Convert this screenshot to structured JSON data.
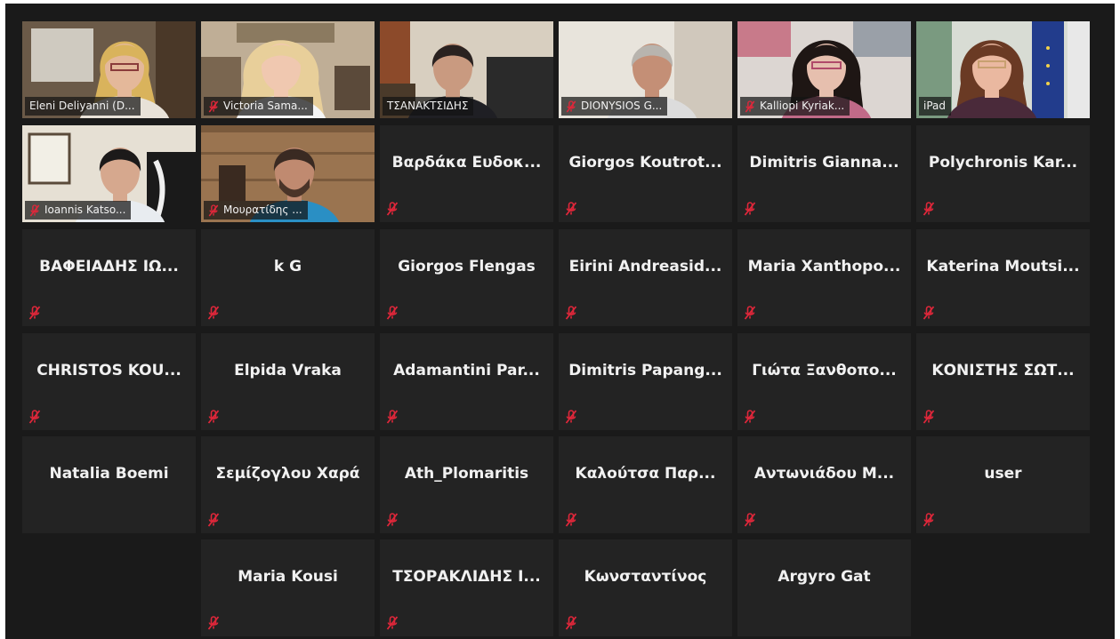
{
  "meeting": {
    "participants": [
      {
        "name": "Eleni Deliyanni (D...",
        "video": true,
        "muted": false,
        "active": false,
        "scene": "blonde-woman-glasses-blinds-icon"
      },
      {
        "name": "Victoria Sama...",
        "video": true,
        "muted": true,
        "active": false,
        "scene": "blonde-woman-room-icon"
      },
      {
        "name": "ΤΣΑΝΑΚΤΣΙΔΗΣ",
        "video": true,
        "muted": false,
        "active": false,
        "scene": "man-office-curtain-icon"
      },
      {
        "name": "DIONYSIOS G...",
        "video": true,
        "muted": true,
        "active": false,
        "scene": "grey-hair-man-icon"
      },
      {
        "name": "Kalliopi Kyriak...",
        "video": true,
        "muted": true,
        "active": false,
        "scene": "dark-hair-woman-glasses-icon"
      },
      {
        "name": "iPad",
        "video": true,
        "muted": false,
        "active": true,
        "scene": "woman-eu-flag-icon"
      },
      {
        "name": "Ioannis Katso...",
        "video": true,
        "muted": true,
        "active": false,
        "scene": "man-room-paintings-icon"
      },
      {
        "name": "Μουρατίδης ...",
        "video": true,
        "muted": true,
        "active": false,
        "scene": "bearded-man-wood-wall-icon"
      },
      {
        "name": "Βαρδάκα Ευδοκ...",
        "video": false,
        "muted": true
      },
      {
        "name": "Giorgos Koutrot...",
        "video": false,
        "muted": true
      },
      {
        "name": "Dimitris Gianna...",
        "video": false,
        "muted": true
      },
      {
        "name": "Polychronis Kar...",
        "video": false,
        "muted": true
      },
      {
        "name": "ΒΑΦΕΙΑΔΗΣ ΙΩ...",
        "video": false,
        "muted": true
      },
      {
        "name": "k G",
        "video": false,
        "muted": true
      },
      {
        "name": "Giorgos Flengas",
        "video": false,
        "muted": true
      },
      {
        "name": "Eirini Andreasid...",
        "video": false,
        "muted": true
      },
      {
        "name": "Maria Xanthopo...",
        "video": false,
        "muted": true
      },
      {
        "name": "Katerina Moutsi...",
        "video": false,
        "muted": true
      },
      {
        "name": "CHRISTOS KOU...",
        "video": false,
        "muted": true
      },
      {
        "name": "Elpida Vraka",
        "video": false,
        "muted": true
      },
      {
        "name": "Adamantini Par...",
        "video": false,
        "muted": true
      },
      {
        "name": "Dimitris Papang...",
        "video": false,
        "muted": true
      },
      {
        "name": "Γιώτα Ξανθοπο...",
        "video": false,
        "muted": true
      },
      {
        "name": "ΚΟΝΙΣΤΗΣ ΣΩΤ...",
        "video": false,
        "muted": true
      },
      {
        "name": "Natalia Boemi",
        "video": false,
        "muted": false
      },
      {
        "name": "Σεμίζογλου Χαρά",
        "video": false,
        "muted": true
      },
      {
        "name": "Ath_Plomaritis",
        "video": false,
        "muted": true
      },
      {
        "name": "Καλούτσα Παρ...",
        "video": false,
        "muted": true
      },
      {
        "name": "Αντωνιάδου Μ...",
        "video": false,
        "muted": true
      },
      {
        "name": "user",
        "video": false,
        "muted": true
      },
      {
        "name": "Maria Kousi",
        "video": false,
        "muted": true
      },
      {
        "name": "ΤΣΟΡΑΚΛΙΔΗΣ Ι...",
        "video": false,
        "muted": true
      },
      {
        "name": "Κωνσταντίνος",
        "video": false,
        "muted": true
      },
      {
        "name": "Argyro Gat",
        "video": false,
        "muted": false
      }
    ]
  },
  "colors": {
    "background": "#1a1a1a",
    "tile": "#232323",
    "muted_icon": "#e0273a",
    "active_speaker_border": "#c9e06a",
    "text": "#f1f1f1"
  }
}
